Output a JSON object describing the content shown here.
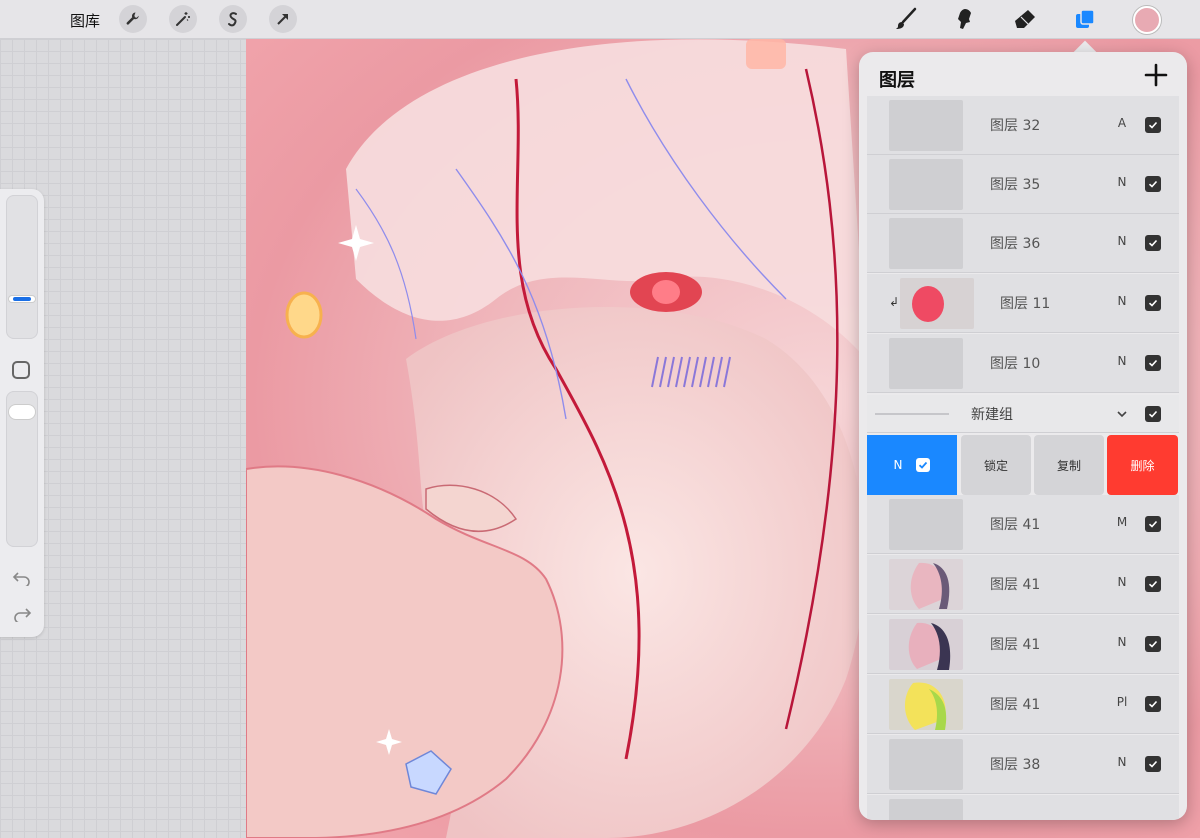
{
  "toolbar": {
    "gallery_label": "图库",
    "active_color": "#e8aab3",
    "accent_color": "#1a88ff",
    "left_icons": [
      "wrench-icon",
      "magic-wand-icon",
      "selection-icon",
      "transform-arrow-icon"
    ],
    "right_tools": [
      "brush-icon",
      "smudge-icon",
      "eraser-icon",
      "layers-icon"
    ]
  },
  "sidebar": {
    "brush_size_icon": "size-slider",
    "modify_icon": "square-icon",
    "undo_icon": "undo-icon",
    "redo_icon": "redo-icon"
  },
  "layers_panel": {
    "title": "图层",
    "add_icon": "plus-icon",
    "layers_top": [
      {
        "name": "图层 32",
        "blend": "A",
        "visible": true
      },
      {
        "name": "图层 35",
        "blend": "N",
        "visible": true
      },
      {
        "name": "图层 36",
        "blend": "N",
        "visible": true
      },
      {
        "name": "图层 11",
        "blend": "N",
        "visible": true,
        "clipped": true
      },
      {
        "name": "图层 10",
        "blend": "N",
        "visible": true
      }
    ],
    "group": {
      "name": "新建组",
      "visible": true
    },
    "actions": {
      "blend": "N",
      "lock": "锁定",
      "duplicate": "复制",
      "delete": "删除",
      "delete_color": "#ff3b30"
    },
    "layers_bottom": [
      {
        "name": "图层 41",
        "blend": "M",
        "visible": true
      },
      {
        "name": "图层 41",
        "blend": "N",
        "visible": true
      },
      {
        "name": "图层 41",
        "blend": "N",
        "visible": true
      },
      {
        "name": "图层 41",
        "blend": "Pl",
        "visible": true
      },
      {
        "name": "图层 38",
        "blend": "N",
        "visible": true
      }
    ]
  }
}
